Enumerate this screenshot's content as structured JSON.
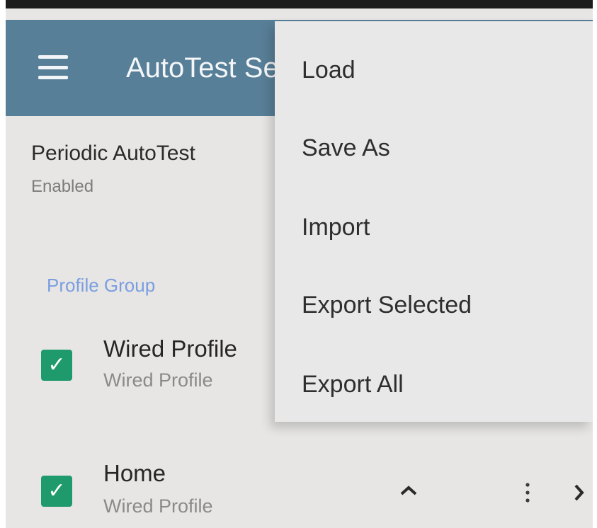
{
  "app": {
    "title": "AutoTest Settings"
  },
  "periodic": {
    "title": "Periodic AutoTest",
    "status": "Enabled"
  },
  "profile_group": {
    "label": "Profile Group"
  },
  "profiles": [
    {
      "name": "Wired Profile",
      "type": "Wired Profile",
      "checked": true
    },
    {
      "name": "Home",
      "type": "Wired Profile",
      "checked": true
    }
  ],
  "overflow_menu": {
    "items": [
      {
        "label": "Load"
      },
      {
        "label": "Save As"
      },
      {
        "label": "Import"
      },
      {
        "label": "Export Selected"
      },
      {
        "label": "Export All"
      }
    ]
  },
  "icons": {
    "menu": "hamburger-menu-icon",
    "check": "checkmark-icon",
    "collapse": "chevron-up-icon",
    "more": "more-vertical-icon",
    "next": "chevron-right-icon"
  },
  "colors": {
    "appbar": "#587f98",
    "background": "#e7e6e4",
    "checkbox": "#1f9a6c",
    "group_label": "#7a9ee0",
    "menu_bg": "#e8e8e8"
  }
}
